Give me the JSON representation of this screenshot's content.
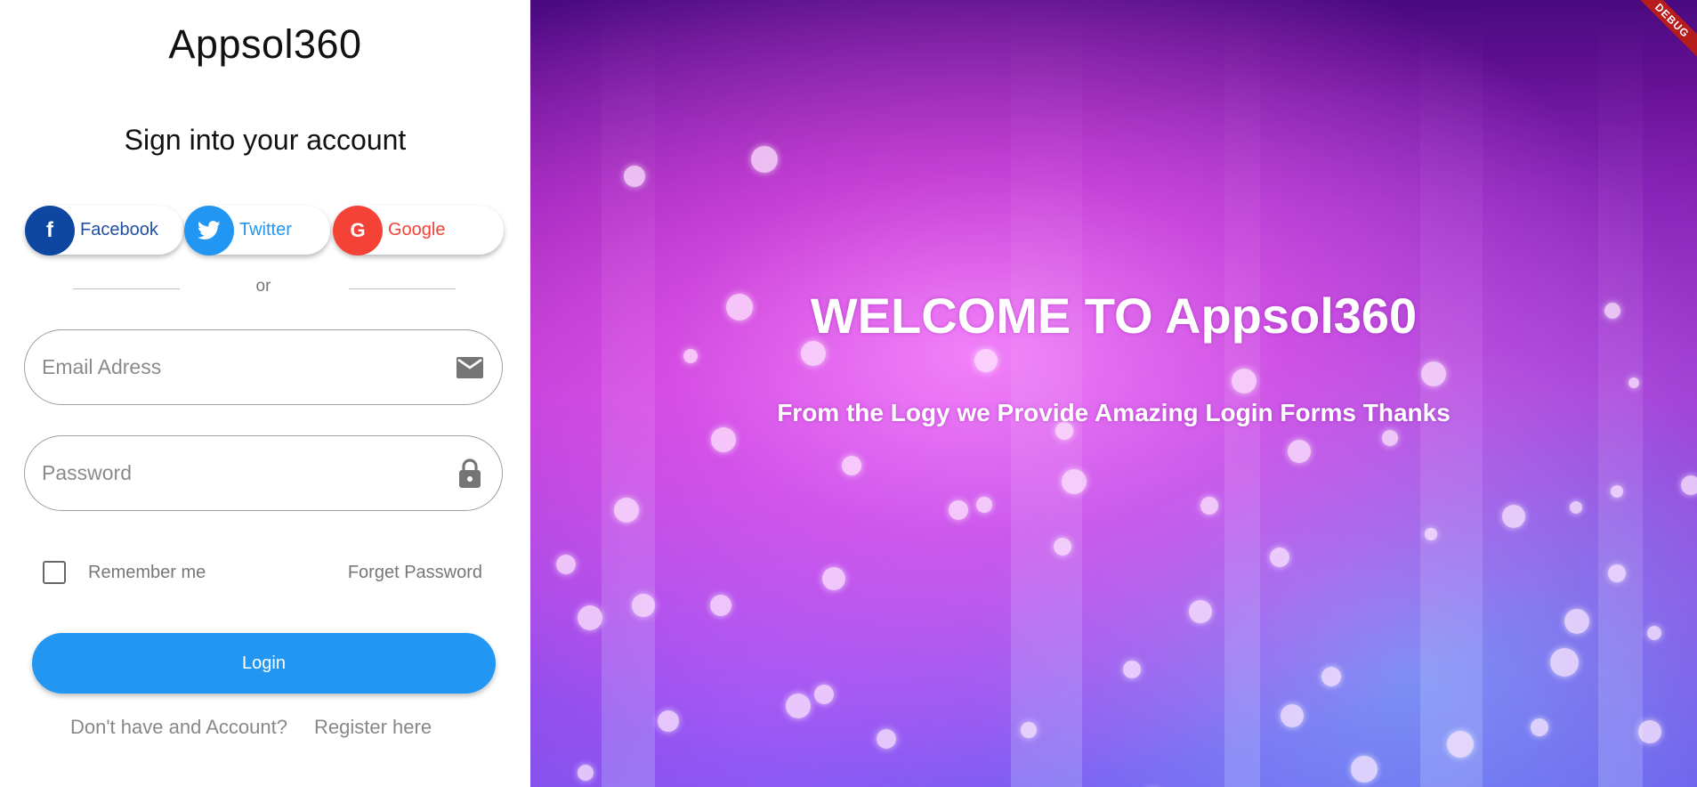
{
  "app": {
    "title": "Appsol360"
  },
  "login": {
    "subtitle": "Sign into your account",
    "social": {
      "facebook": {
        "label": "Facebook",
        "glyph": "f",
        "color": "#0d47a1"
      },
      "twitter": {
        "label": "Twitter",
        "color": "#2196f3"
      },
      "google": {
        "label": "Google",
        "glyph": "G",
        "color": "#f44336"
      }
    },
    "divider_text": "or",
    "email": {
      "placeholder": "Email Adress",
      "value": "",
      "icon": "mail-icon"
    },
    "password": {
      "placeholder": "Password",
      "value": "",
      "icon": "lock-icon"
    },
    "remember_label": "Remember me",
    "remember_checked": false,
    "forget_label": "Forget Password",
    "login_label": "Login",
    "no_account_text": "Don't have and Account?",
    "register_label": "Register here",
    "accent_color": "#2196f3"
  },
  "hero": {
    "welcome": "WELCOME TO Appsol360",
    "tagline": "From the Logy we Provide Amazing Login Forms Thanks"
  },
  "debug_banner": "DEBUG"
}
